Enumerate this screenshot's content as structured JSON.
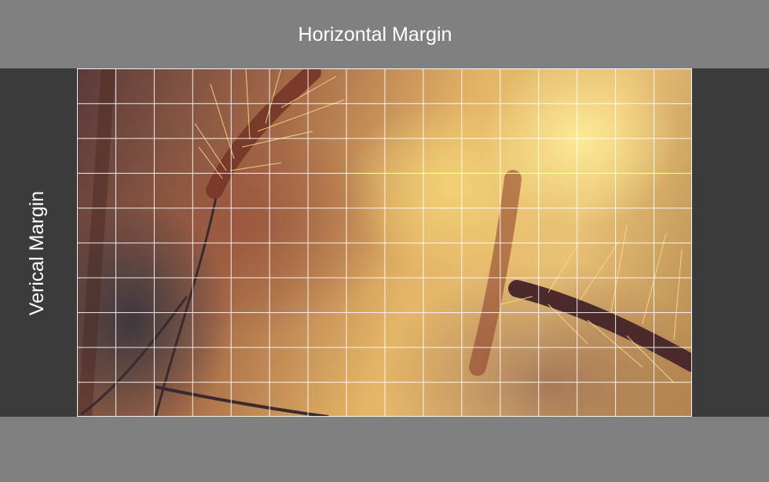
{
  "horizontal_margin": {
    "label": "Horizontal Margin"
  },
  "vertical_margin": {
    "label": "Verical Margin"
  },
  "image": {
    "description_icon": "wheat-photo",
    "grid": true
  }
}
